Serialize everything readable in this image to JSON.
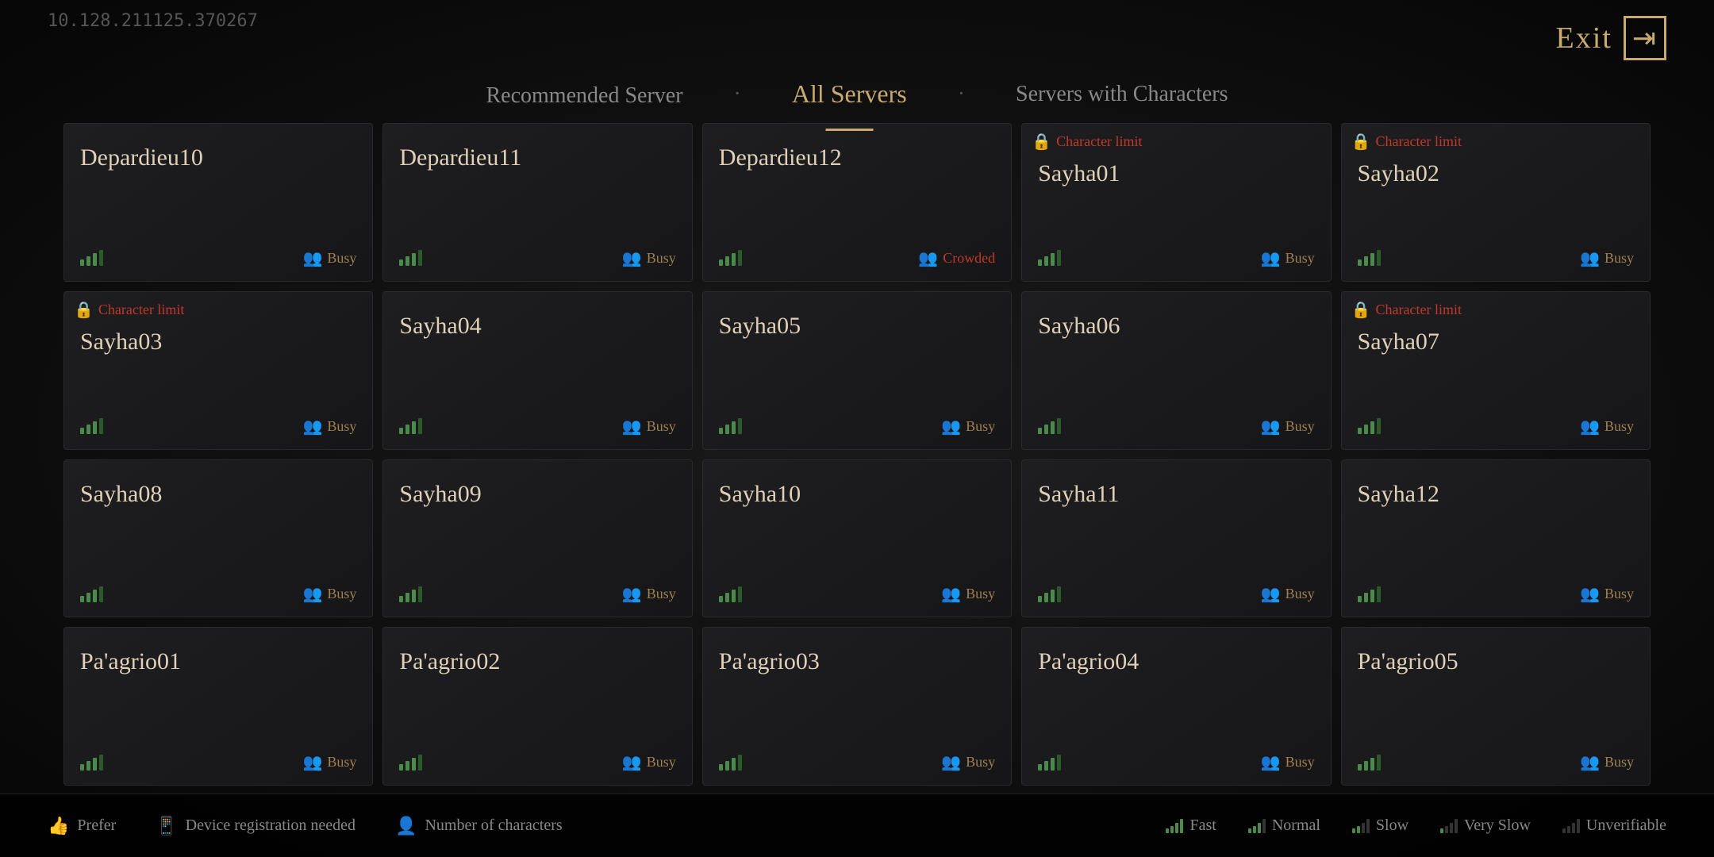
{
  "ip_display": "10.128.211125.370267",
  "exit_label": "Exit",
  "tabs": [
    {
      "id": "recommended",
      "label": "Recommended Server",
      "active": false
    },
    {
      "id": "all",
      "label": "All Servers",
      "active": true
    },
    {
      "id": "characters",
      "label": "Servers with Characters",
      "active": false
    }
  ],
  "servers": [
    {
      "id": 1,
      "name": "Depardieu10",
      "status": "Busy",
      "char_limit": false,
      "signal": 3
    },
    {
      "id": 2,
      "name": "Depardieu11",
      "status": "Busy",
      "char_limit": false,
      "signal": 3
    },
    {
      "id": 3,
      "name": "Depardieu12",
      "status": "Crowded",
      "char_limit": false,
      "signal": 3
    },
    {
      "id": 4,
      "name": "Sayha01",
      "status": "Busy",
      "char_limit": true,
      "signal": 3
    },
    {
      "id": 5,
      "name": "Sayha02",
      "status": "Busy",
      "char_limit": true,
      "signal": 3
    },
    {
      "id": 6,
      "name": "Sayha03",
      "status": "Busy",
      "char_limit": true,
      "signal": 3
    },
    {
      "id": 7,
      "name": "Sayha04",
      "status": "Busy",
      "char_limit": false,
      "signal": 3
    },
    {
      "id": 8,
      "name": "Sayha05",
      "status": "Busy",
      "char_limit": false,
      "signal": 3
    },
    {
      "id": 9,
      "name": "Sayha06",
      "status": "Busy",
      "char_limit": false,
      "signal": 3
    },
    {
      "id": 10,
      "name": "Sayha07",
      "status": "Busy",
      "char_limit": true,
      "signal": 3
    },
    {
      "id": 11,
      "name": "Sayha08",
      "status": "Busy",
      "char_limit": false,
      "signal": 3
    },
    {
      "id": 12,
      "name": "Sayha09",
      "status": "Busy",
      "char_limit": false,
      "signal": 3
    },
    {
      "id": 13,
      "name": "Sayha10",
      "status": "Busy",
      "char_limit": false,
      "signal": 3
    },
    {
      "id": 14,
      "name": "Sayha11",
      "status": "Busy",
      "char_limit": false,
      "signal": 3
    },
    {
      "id": 15,
      "name": "Sayha12",
      "status": "Busy",
      "char_limit": false,
      "signal": 3
    },
    {
      "id": 16,
      "name": "Pa'agrio01",
      "status": "Busy",
      "char_limit": false,
      "signal": 3
    },
    {
      "id": 17,
      "name": "Pa'agrio02",
      "status": "Busy",
      "char_limit": false,
      "signal": 3
    },
    {
      "id": 18,
      "name": "Pa'agrio03",
      "status": "Busy",
      "char_limit": false,
      "signal": 3
    },
    {
      "id": 19,
      "name": "Pa'agrio04",
      "status": "Busy",
      "char_limit": false,
      "signal": 3
    },
    {
      "id": 20,
      "name": "Pa'agrio05",
      "status": "Busy",
      "char_limit": false,
      "signal": 3
    }
  ],
  "legend": {
    "prefer_label": "Prefer",
    "device_label": "Device registration needed",
    "characters_label": "Number of characters"
  },
  "speed_legend": [
    {
      "label": "Fast",
      "bars": 4
    },
    {
      "label": "Normal",
      "bars": 3
    },
    {
      "label": "Slow",
      "bars": 2
    },
    {
      "label": "Very Slow",
      "bars": 1
    },
    {
      "label": "Unverifiable",
      "bars": 0
    }
  ],
  "char_limit_label": "Character limit"
}
